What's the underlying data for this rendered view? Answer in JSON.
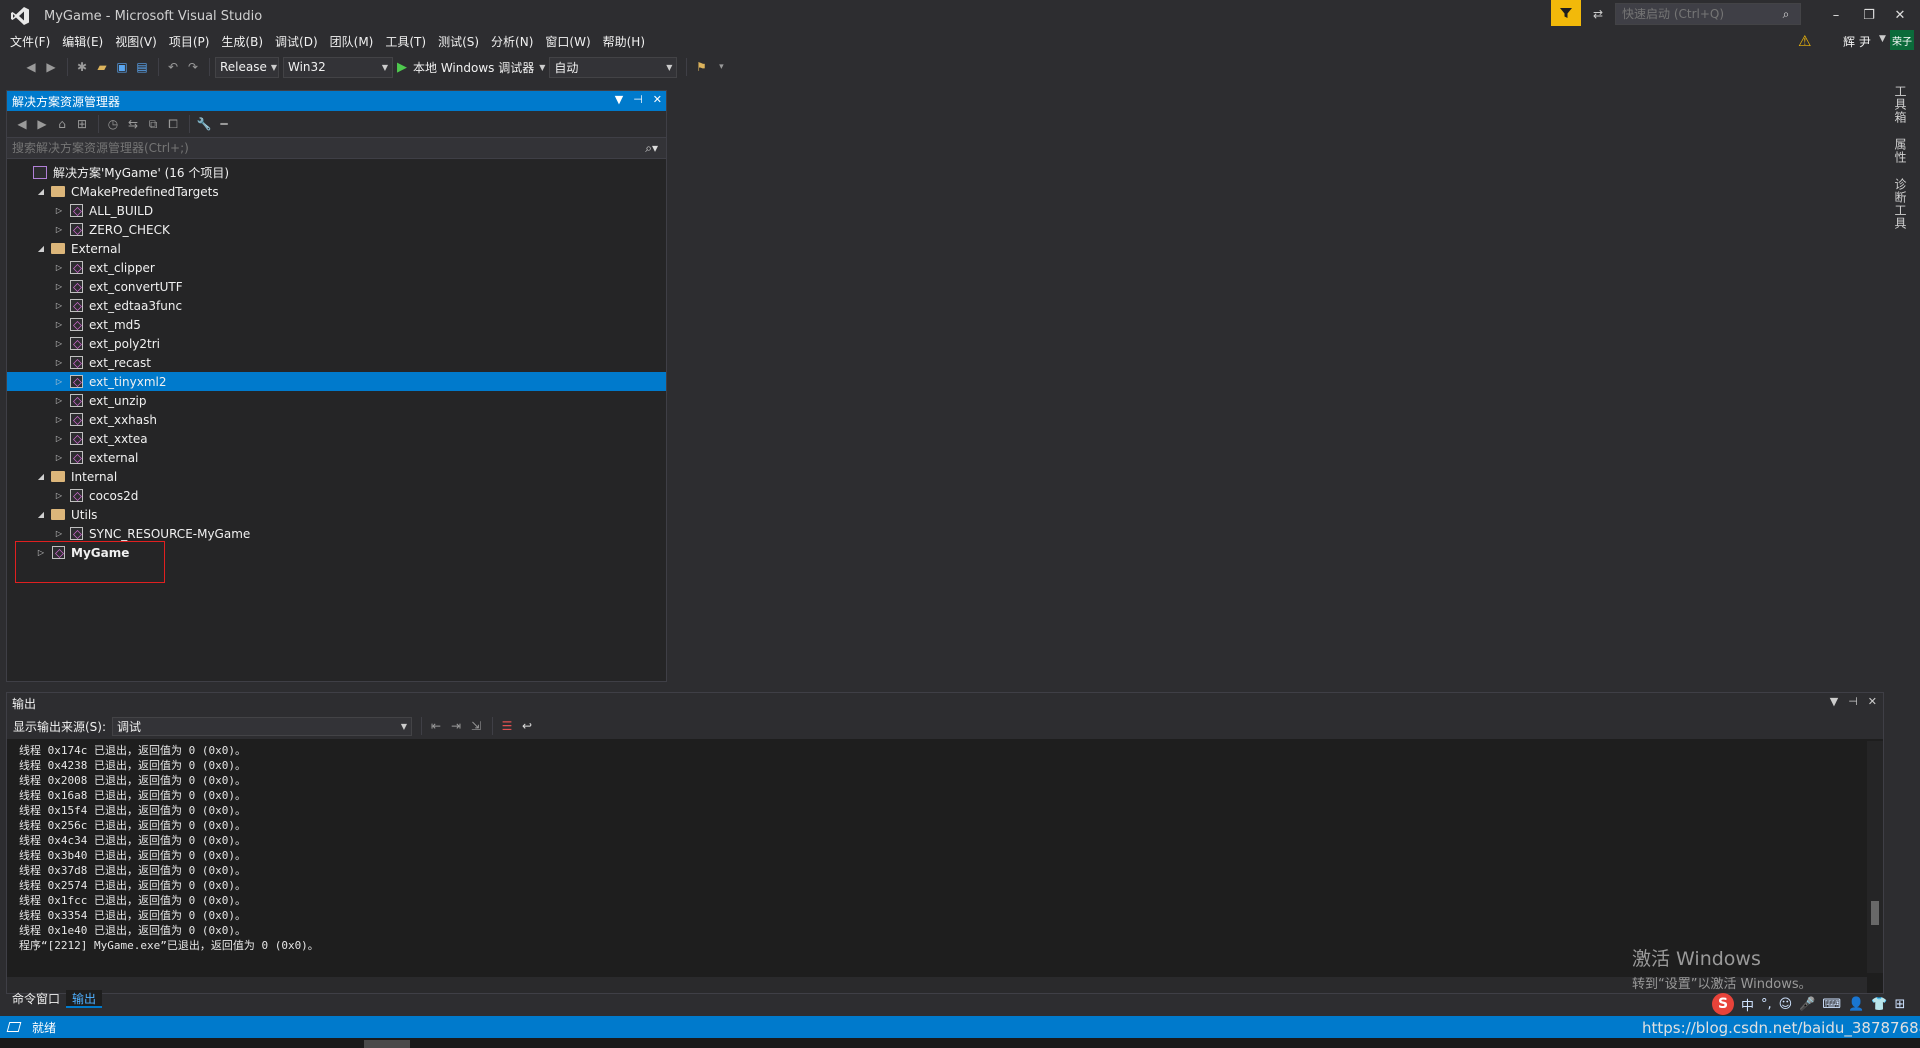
{
  "window": {
    "title": "MyGame - Microsoft Visual Studio",
    "quick_launch_placeholder": "快速启动 (Ctrl+Q)",
    "controls": [
      "–",
      "❐",
      "✕"
    ]
  },
  "menu": [
    "文件(F)",
    "编辑(E)",
    "视图(V)",
    "项目(P)",
    "生成(B)",
    "调试(D)",
    "团队(M)",
    "工具(T)",
    "测试(S)",
    "分析(N)",
    "窗口(W)",
    "帮助(H)"
  ],
  "user": {
    "name": "辉 尹",
    "avatar": "荣子"
  },
  "toolbar": {
    "configuration": "Release",
    "platform": "Win32",
    "debugger": "本地 Windows 调试器",
    "mode": "自动"
  },
  "solution_explorer": {
    "title": "解决方案资源管理器",
    "search_placeholder": "搜索解决方案资源管理器(Ctrl+;)",
    "tree": [
      {
        "label": "解决方案'MyGame' (16 个项目)",
        "level": 0,
        "type": "solution",
        "expander": ""
      },
      {
        "label": "CMakePredefinedTargets",
        "level": 1,
        "type": "folder",
        "expander": "expanded"
      },
      {
        "label": "ALL_BUILD",
        "level": 2,
        "type": "project",
        "expander": "collapsed"
      },
      {
        "label": "ZERO_CHECK",
        "level": 2,
        "type": "project",
        "expander": "collapsed"
      },
      {
        "label": "External",
        "level": 1,
        "type": "folder",
        "expander": "expanded"
      },
      {
        "label": "ext_clipper",
        "level": 2,
        "type": "project",
        "expander": "collapsed"
      },
      {
        "label": "ext_convertUTF",
        "level": 2,
        "type": "project",
        "expander": "collapsed"
      },
      {
        "label": "ext_edtaa3func",
        "level": 2,
        "type": "project",
        "expander": "collapsed"
      },
      {
        "label": "ext_md5",
        "level": 2,
        "type": "project",
        "expander": "collapsed"
      },
      {
        "label": "ext_poly2tri",
        "level": 2,
        "type": "project",
        "expander": "collapsed"
      },
      {
        "label": "ext_recast",
        "level": 2,
        "type": "project",
        "expander": "collapsed"
      },
      {
        "label": "ext_tinyxml2",
        "level": 2,
        "type": "project",
        "expander": "collapsed",
        "selected": true
      },
      {
        "label": "ext_unzip",
        "level": 2,
        "type": "project",
        "expander": "collapsed"
      },
      {
        "label": "ext_xxhash",
        "level": 2,
        "type": "project",
        "expander": "collapsed"
      },
      {
        "label": "ext_xxtea",
        "level": 2,
        "type": "project",
        "expander": "collapsed"
      },
      {
        "label": "external",
        "level": 2,
        "type": "project",
        "expander": "collapsed"
      },
      {
        "label": "Internal",
        "level": 1,
        "type": "folder",
        "expander": "expanded"
      },
      {
        "label": "cocos2d",
        "level": 2,
        "type": "project",
        "expander": "collapsed"
      },
      {
        "label": "Utils",
        "level": 1,
        "type": "folder",
        "expander": "expanded"
      },
      {
        "label": "SYNC_RESOURCE-MyGame",
        "level": 2,
        "type": "project",
        "expander": "collapsed"
      },
      {
        "label": "MyGame",
        "level": 1,
        "type": "project",
        "expander": "collapsed",
        "bold": true
      }
    ]
  },
  "side_tabs": [
    "工具箱",
    "属性",
    "诊断工具"
  ],
  "output": {
    "title": "输出",
    "source_label": "显示输出来源(S):",
    "source_value": "调试",
    "lines": [
      "线程 0x174c 已退出，返回值为 0 (0x0)。",
      "线程 0x4238 已退出，返回值为 0 (0x0)。",
      "线程 0x2008 已退出，返回值为 0 (0x0)。",
      "线程 0x16a8 已退出，返回值为 0 (0x0)。",
      "线程 0x15f4 已退出，返回值为 0 (0x0)。",
      "线程 0x256c 已退出，返回值为 0 (0x0)。",
      "线程 0x4c34 已退出，返回值为 0 (0x0)。",
      "线程 0x3b40 已退出，返回值为 0 (0x0)。",
      "线程 0x37d8 已退出，返回值为 0 (0x0)。",
      "线程 0x2574 已退出，返回值为 0 (0x0)。",
      "线程 0x1fcc 已退出，返回值为 0 (0x0)。",
      "线程 0x3354 已退出，返回值为 0 (0x0)。",
      "线程 0x1e40 已退出，返回值为 0 (0x0)。",
      "程序“[2212] MyGame.exe”已退出，返回值为 0 (0x0)。"
    ]
  },
  "activation": {
    "line1": "激活 Windows",
    "line2": "转到“设置”以激活 Windows。"
  },
  "bottom_tabs": [
    {
      "label": "命令窗口",
      "active": false
    },
    {
      "label": "输出",
      "active": true
    }
  ],
  "status": {
    "text": "就绪"
  },
  "watermark": "https://blog.csdn.net/baidu_38787688",
  "ime": {
    "logo": "S",
    "items": [
      "中",
      "°,",
      "☺",
      "🎤",
      "⌨",
      "👤",
      "👕",
      "⊞"
    ]
  },
  "colors": {
    "accent": "#007acc",
    "background": "#2d2d30",
    "highlight_box": "#e02020"
  }
}
